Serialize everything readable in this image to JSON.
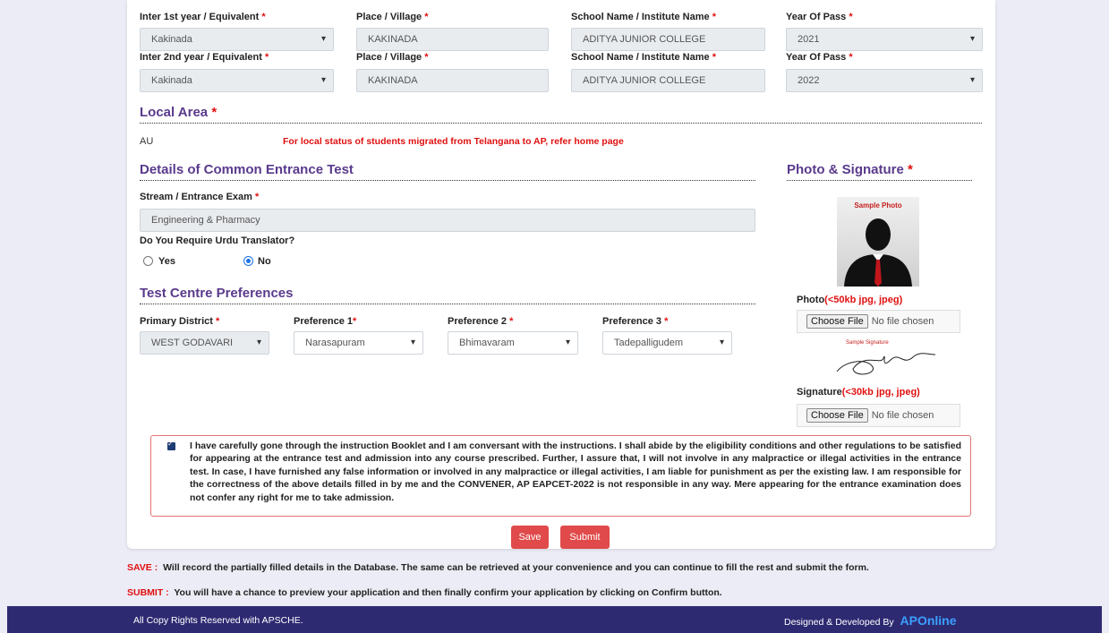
{
  "education": {
    "rows": [
      {
        "course_label": "Inter 1st year / Equivalent",
        "district": "Kakinada",
        "place_label": "Place / Village",
        "place": "KAKINADA",
        "school_label": "School Name / Institute Name",
        "school": "ADITYA JUNIOR COLLEGE",
        "year_label": "Year Of Pass",
        "year": "2021"
      },
      {
        "course_label": "Inter 2nd year / Equivalent",
        "district": "Kakinada",
        "place_label": "Place / Village",
        "place": "KAKINADA",
        "school_label": "School Name / Institute Name",
        "school": "ADITYA JUNIOR COLLEGE",
        "year_label": "Year Of Pass",
        "year": "2022"
      }
    ],
    "required_mark": "*"
  },
  "local_area": {
    "title": "Local Area",
    "value": "AU",
    "note": "For local status of students migrated from Telangana to AP, refer home page"
  },
  "cet": {
    "title": "Details of Common Entrance Test",
    "stream_label": "Stream / Entrance Exam",
    "stream_value": "Engineering & Pharmacy",
    "urdu_label": "Do You Require Urdu Translator?",
    "yes_label": "Yes",
    "no_label": "No",
    "selected": "No"
  },
  "test_centre": {
    "title": "Test Centre Preferences",
    "primary_label": "Primary District",
    "primary_value": "WEST GODAVARI",
    "pref1_label": "Preference 1",
    "pref1_value": "Narasapuram",
    "pref2_label": "Preference 2",
    "pref2_value": "Bhimavaram",
    "pref3_label": "Preference 3",
    "pref3_value": "Tadepalligudem"
  },
  "photo_sig": {
    "title": "Photo & Signature",
    "sample_photo_text": "Sample Photo",
    "photo_label": "Photo",
    "photo_hint": "(<50kb jpg, jpeg)",
    "sample_sig_text": "Sample Signature",
    "signature_label": "Signature",
    "signature_hint": "(<30kb jpg, jpeg)",
    "choose_file": "Choose File",
    "no_file": "No file chosen"
  },
  "declaration": {
    "checked": true,
    "text": "I have carefully gone through the instruction Booklet and I am conversant with the instructions. I shall abide by the eligibility conditions and other regulations to be satisfied for appearing at the entrance test and admission into any course prescribed. Further, I assure that, I will not involve in any malpractice or illegal activities in the entrance test. In case, I have furnished any false information or involved in any malpractice or illegal activities, I am liable for punishment as per the existing law. I am responsible for the correctness of the above details filled in by me and the CONVENER, AP EAPCET-2022 is not responsible in any way. Mere appearing for the entrance examination does not confer any right for me to take admission."
  },
  "actions": {
    "save": "Save",
    "submit": "Submit"
  },
  "notes": {
    "save_key": "SAVE :",
    "save_text": "Will record the partially filled details in the Database. The same can be retrieved at your convenience and you can continue to fill the rest and submit the form.",
    "submit_key": "SUBMIT :",
    "submit_text": "You will have a chance to preview your application and then finally confirm your application by clicking on Confirm button."
  },
  "footer": {
    "copyright": "All Copy Rights Reserved with APSCHE.",
    "designed_by": "Designed & Developed By",
    "brand": "APOnline"
  },
  "colors": {
    "section_title": "#5a3a8c",
    "required": "#e01010",
    "button": "#e04a4a",
    "footer": "#2e2a72"
  }
}
